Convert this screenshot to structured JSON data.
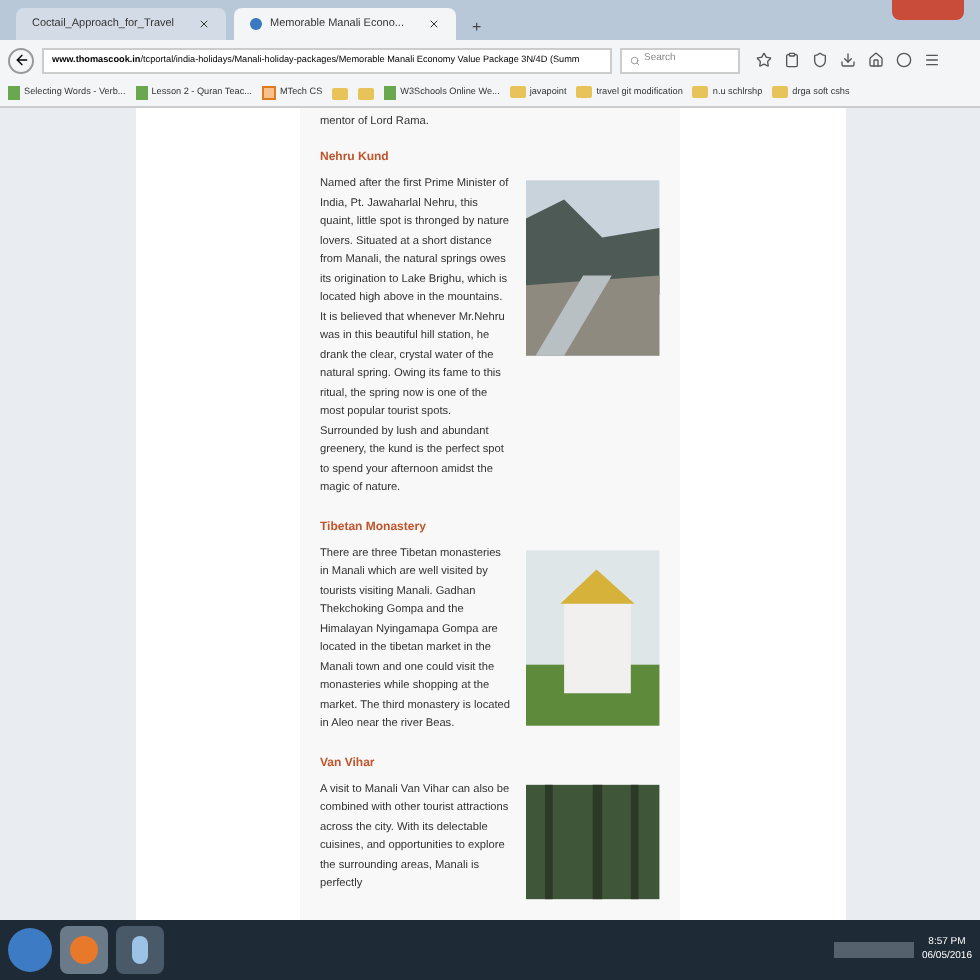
{
  "tabs": [
    {
      "label": "Coctail_Approach_for_Travel",
      "selected": false
    },
    {
      "label": "Memorable Manali Econo...",
      "selected": true
    }
  ],
  "new_tab": "+",
  "address": {
    "domain": "www.thomascook.in",
    "path": "/tcportal/india-holidays/Manali-holiday-packages/Memorable Manali Economy Value Package 3N/4D (Summ"
  },
  "search": {
    "placeholder": "Search"
  },
  "bookmarks": [
    {
      "label": "Selecting Words - Verb...",
      "kind": "page"
    },
    {
      "label": "Lesson 2 - Quran Teac...",
      "kind": "page"
    },
    {
      "label": "MTech CS",
      "kind": "app"
    },
    {
      "kind": "folder"
    },
    {
      "kind": "folder"
    },
    {
      "label": "W3Schools Online We...",
      "kind": "page"
    },
    {
      "label": "javapoint",
      "kind": "folder"
    },
    {
      "label": "travel git modification",
      "kind": "folder"
    },
    {
      "label": "n.u schlrshp",
      "kind": "folder"
    },
    {
      "label": "drga soft cshs",
      "kind": "folder"
    }
  ],
  "intro_line": "mentor of Lord Rama.",
  "sections": [
    {
      "title": "Nehru Kund",
      "kind": "mountain-river",
      "text": "Named after the first Prime Minister of India, Pt. Jawaharlal Nehru, this quaint, little spot is thronged by nature lovers. Situated at a short distance from Manali, the natural springs owes its origination to Lake Brighu, which is located high above in the mountains. It is believed that whenever Mr.Nehru was in this beautiful hill station, he drank the clear, crystal water of the natural spring. Owing its fame to this ritual, the spring now is one of the most popular tourist spots. Surrounded by lush and abundant greenery, the kund is the perfect spot to spend your afternoon amidst the magic of nature."
    },
    {
      "title": "Tibetan Monastery",
      "kind": "monastery",
      "text": "There are three Tibetan monasteries in Manali which are well visited by tourists visiting Manali. Gadhan Thekchoking Gompa and the Himalayan Nyingamapa Gompa are located in the tibetan market in the Manali town and one could visit the monasteries while shopping at the market. The third monastery is located in Aleo near the river Beas."
    },
    {
      "title": "Van Vihar",
      "kind": "forest",
      "text": "A visit to Manali Van Vihar can also be combined with other tourist attractions across the city. With its delectable cuisines, and opportunities to explore the surrounding areas, Manali is perfectly"
    }
  ],
  "clock": {
    "time": "8:57 PM",
    "date": "06/05/2016"
  }
}
